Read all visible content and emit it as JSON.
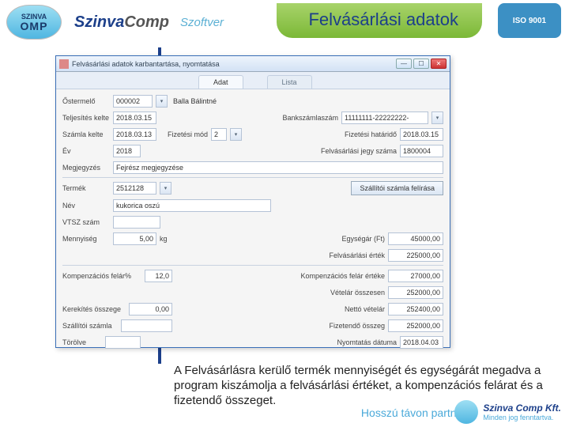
{
  "header": {
    "logo_small": "SZINVA",
    "logo_big": "OMP",
    "brand1": "Szinva",
    "brand2": "Comp",
    "brand_sub": "Szoftver",
    "title_pill": "Felvásárlási adatok",
    "iso": "ISO 9001"
  },
  "window": {
    "title": "Felvásárlási adatok karbantartása, nyomtatása",
    "tab_active": "Adat",
    "tab_inactive": "Lista",
    "fields": {
      "ostermelo_lbl": "Őstermelő",
      "ostermelo_val": "000002",
      "ostermelo_name": "Balla Bálintné",
      "teljesites_lbl": "Teljesítés kelte",
      "teljesites_val": "2018.03.15",
      "bank_lbl": "Bankszámlaszám",
      "bank_val": "11111111-22222222-",
      "szamla_lbl": "Számla kelte",
      "szamla_val": "2018.03.13",
      "fizmod_lbl": "Fizetési mód",
      "fizmod_val": "2",
      "fizhat_lbl": "Fizetési határidő",
      "fizhat_val": "2018.03.15",
      "ev_lbl": "Év",
      "ev_val": "2018",
      "jegyszam_lbl": "Felvásárlási jegy száma",
      "jegyszam_val": "1800004",
      "megj_lbl": "Megjegyzés",
      "megj_val": "Fejrész megjegyzése",
      "termek_lbl": "Termék",
      "termek_val": "2512128",
      "szallitoi_btn": "Szállítói számla felírása",
      "nev_lbl": "Név",
      "nev_val": "kukorica oszú",
      "vtsz_lbl": "VTSZ szám",
      "vtsz_val": "",
      "menny_lbl": "Mennyiség",
      "menny_val": "5,00",
      "menny_unit": "kg",
      "egysegar_lbl": "Egységár (Ft)",
      "egysegar_val": "45000,00",
      "felvert_lbl": "Felvásárlási érték",
      "felvert_val": "225000,00",
      "kompf_lbl": "Kompenzációs felár%",
      "kompf_val": "12,0",
      "kompfe_lbl": "Kompenzációs felár értéke",
      "kompfe_val": "27000,00",
      "vetelar_lbl": "Vételár összesen",
      "vetelar_val": "252000,00",
      "kerekites_lbl": "Kerekítés összege",
      "kerekites_val": "0,00",
      "netto_lbl": "Nettó vételár",
      "netto_val": "252400,00",
      "szallszamla_lbl": "Szállítói számla",
      "szallszamla_val": "",
      "fizetendo_lbl": "Fizetendő összeg",
      "fizetendo_val": "252000,00",
      "torolve_lbl": "Törölve",
      "torolve_val": "",
      "nyomt_lbl": "Nyomtatás dátuma",
      "nyomt_val": "2018.04.03"
    }
  },
  "caption": "A Felvásárlásra kerülő termék mennyiségét és egységárát megadva a program kiszámolja a felvásárlási értéket, a kompenzációs felárat és a fizetendő összeget.",
  "footer": {
    "tagline": "Hosszú távon partner",
    "company": "Szinva Comp Kft.",
    "rights": "Minden jog fenntartva."
  }
}
